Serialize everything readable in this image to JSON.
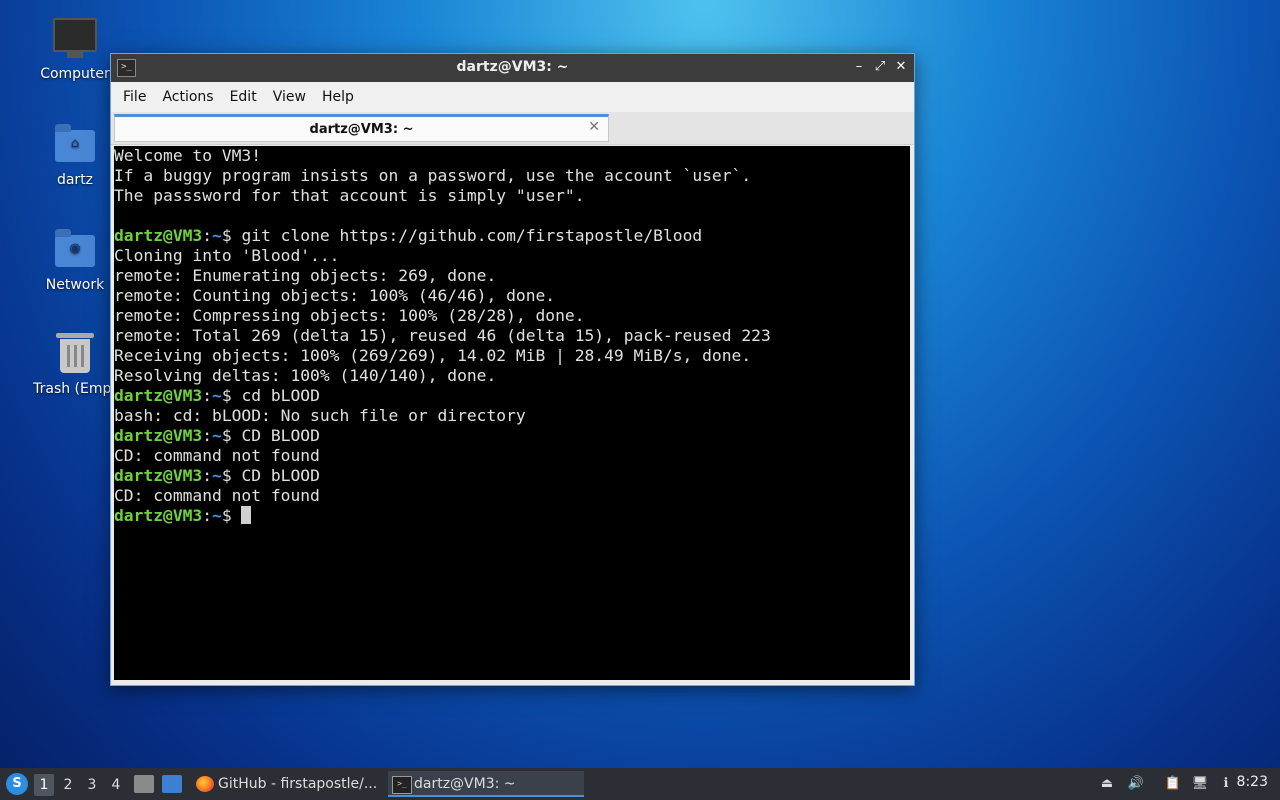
{
  "desktop": {
    "icons": [
      {
        "label": "Computer",
        "icon": "computer-icon"
      },
      {
        "label": "dartz",
        "icon": "home-folder-icon"
      },
      {
        "label": "Network",
        "icon": "network-folder-icon"
      },
      {
        "label": "Trash (Empt",
        "icon": "trash-icon"
      }
    ]
  },
  "window": {
    "title": "dartz@VM3: ~",
    "app_icon": ">_",
    "controls": {
      "minimize": "–",
      "maximize": "⤢",
      "close": "✕"
    },
    "menu": [
      "File",
      "Actions",
      "Edit",
      "View",
      "Help"
    ],
    "tab": {
      "label": "dartz@VM3: ~",
      "close": "✕"
    }
  },
  "terminal": {
    "prompt_user": "dartz@VM3",
    "prompt_sep": ":",
    "prompt_path": "~",
    "prompt_end": "$ ",
    "lines": [
      {
        "text": "Welcome to VM3!"
      },
      {
        "text": "If a buggy program insists on a password, use the account `user`."
      },
      {
        "text": "The passsword for that account is simply \"user\"."
      },
      {
        "text": ""
      },
      {
        "prompt": true,
        "text": "git clone https://github.com/firstapostle/Blood"
      },
      {
        "text": "Cloning into 'Blood'..."
      },
      {
        "text": "remote: Enumerating objects: 269, done."
      },
      {
        "text": "remote: Counting objects: 100% (46/46), done."
      },
      {
        "text": "remote: Compressing objects: 100% (28/28), done."
      },
      {
        "text": "remote: Total 269 (delta 15), reused 46 (delta 15), pack-reused 223"
      },
      {
        "text": "Receiving objects: 100% (269/269), 14.02 MiB | 28.49 MiB/s, done."
      },
      {
        "text": "Resolving deltas: 100% (140/140), done."
      },
      {
        "prompt": true,
        "text": "cd bLOOD"
      },
      {
        "text": "bash: cd: bLOOD: No such file or directory"
      },
      {
        "prompt": true,
        "text": "CD BLOOD"
      },
      {
        "text": "CD: command not found"
      },
      {
        "prompt": true,
        "text": "CD bLOOD"
      },
      {
        "text": "CD: command not found"
      },
      {
        "prompt": true,
        "text": "",
        "cursor": true
      }
    ]
  },
  "taskbar": {
    "start_icon": "lubuntu-start-icon",
    "workspaces": [
      "1",
      "2",
      "3",
      "4"
    ],
    "active_workspace": "1",
    "tasks": [
      {
        "label": "GitHub - firstapostle/...",
        "icon": "firefox-icon"
      },
      {
        "label": "dartz@VM3: ~",
        "icon": "terminal-icon"
      }
    ],
    "tray": [
      "⏏",
      "🔊",
      "📋",
      "🖥",
      "ℹ"
    ],
    "clock": "8:23"
  },
  "colors": {
    "prompt_user": "#6dd33a",
    "prompt_path": "#4d8ee8",
    "terminal_bg": "#000000",
    "accent": "#4a90d9"
  }
}
